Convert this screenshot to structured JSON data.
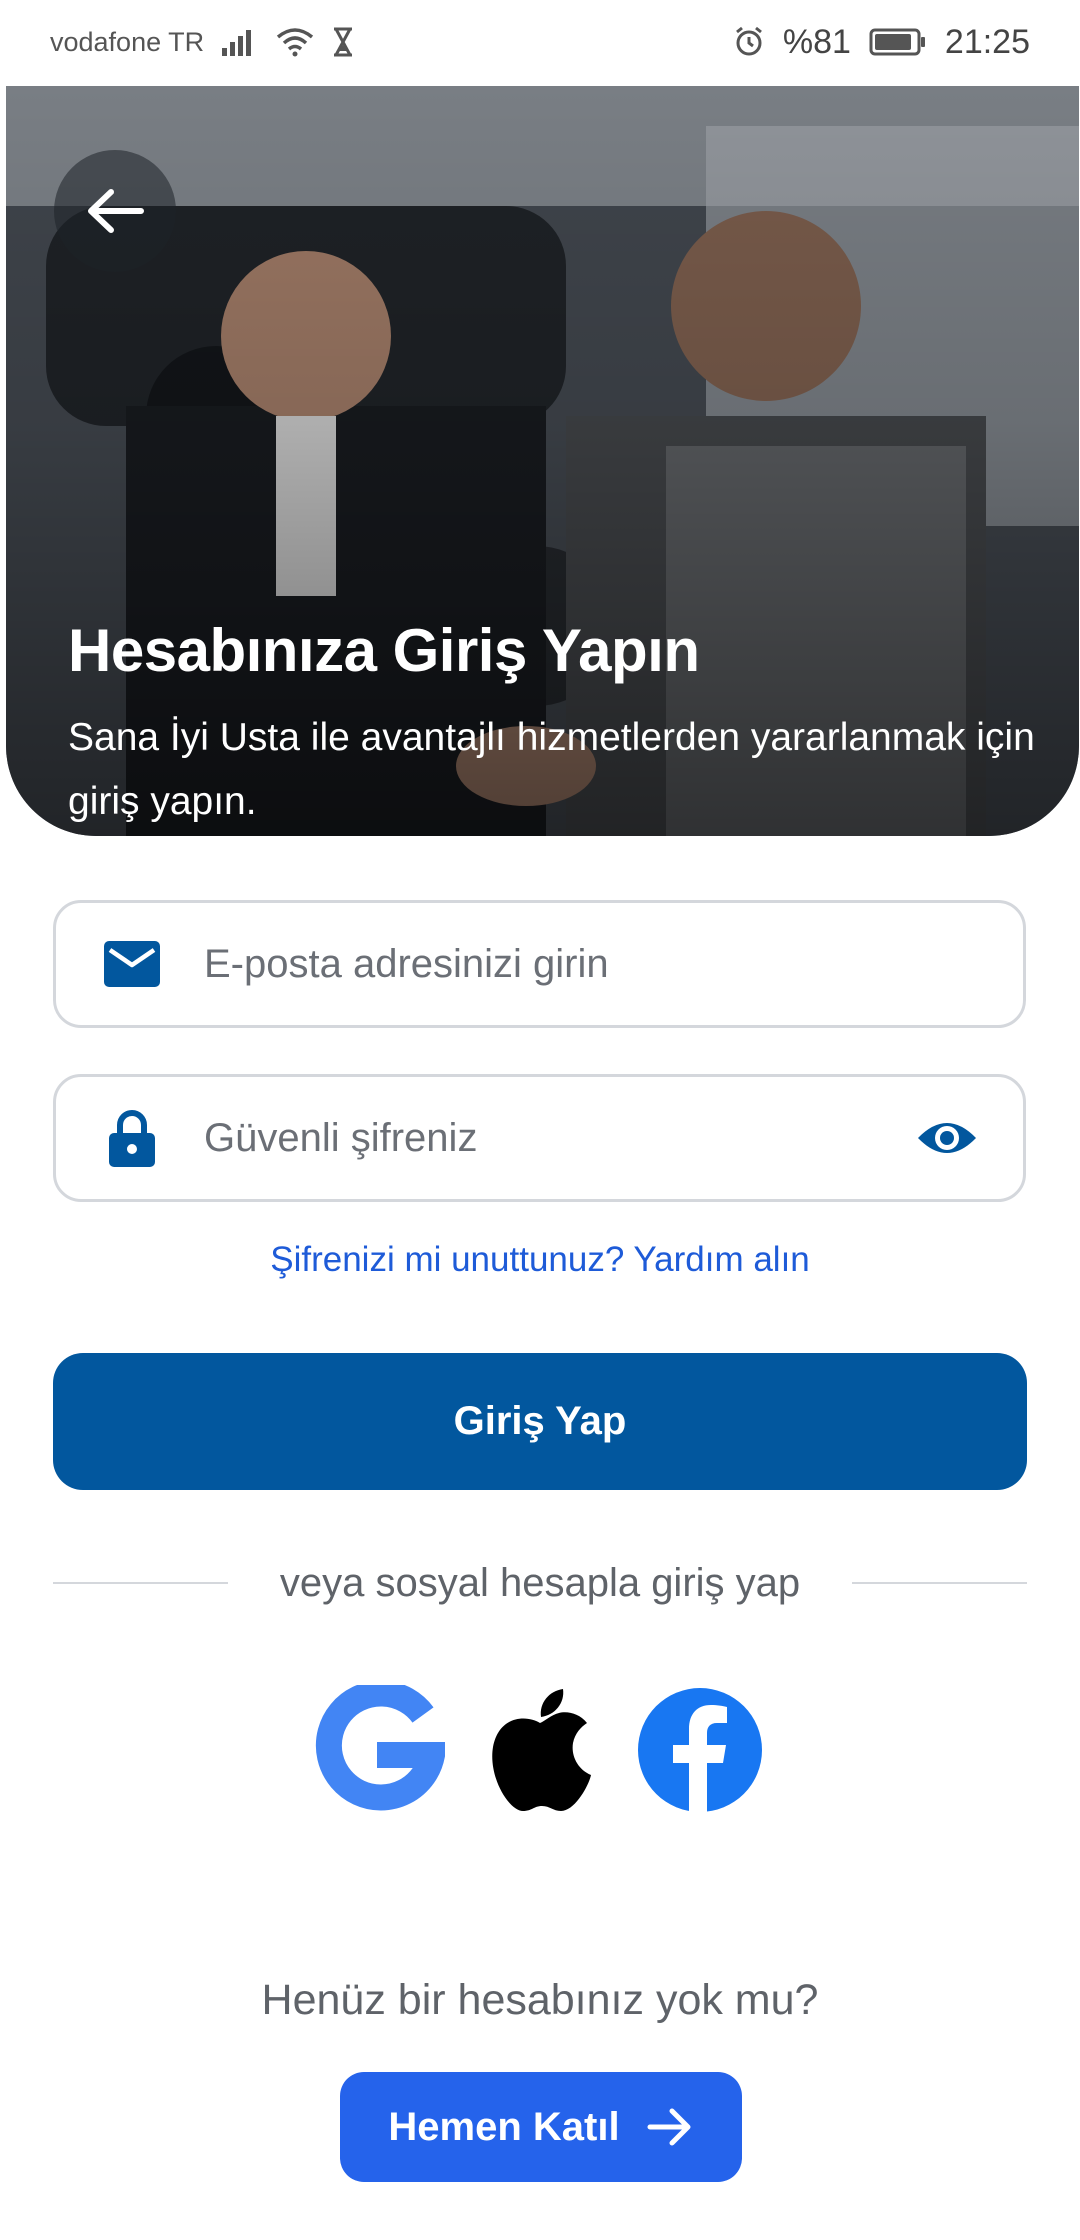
{
  "status_bar": {
    "carrier": "vodafone TR",
    "battery_percent": "%81",
    "time": "21:25",
    "icons": [
      "signal-icon",
      "wifi-icon",
      "hourglass-icon",
      "alarm-icon",
      "battery-icon"
    ]
  },
  "hero": {
    "title": "Hesabınıza Giriş Yapın",
    "subtitle": "Sana İyi Usta ile avantajlı hizmetlerden yararlanmak için giriş yapın.",
    "back_icon": "arrow-left-icon"
  },
  "form": {
    "email": {
      "placeholder": "E-posta adresinizi girin",
      "value": "",
      "icon": "mail-icon"
    },
    "password": {
      "placeholder": "Güvenli şifreniz",
      "value": "",
      "icon": "lock-icon",
      "toggle_icon": "eye-icon"
    },
    "forgot_link": "Şifrenizi mi unuttunuz? Yardım alın",
    "login_label": "Giriş Yap"
  },
  "social": {
    "divider_text": "veya sosyal hesapla giriş yap",
    "providers": [
      "google-icon",
      "apple-icon",
      "facebook-icon"
    ]
  },
  "signup": {
    "prompt": "Henüz bir hesabınız yok mu?",
    "join_label": "Hemen Katıl"
  },
  "colors": {
    "primary": "#02579e",
    "accent": "#2563eb",
    "link": "#1e5bd8",
    "google_blue": "#4285f4",
    "facebook_blue": "#1877f2"
  }
}
